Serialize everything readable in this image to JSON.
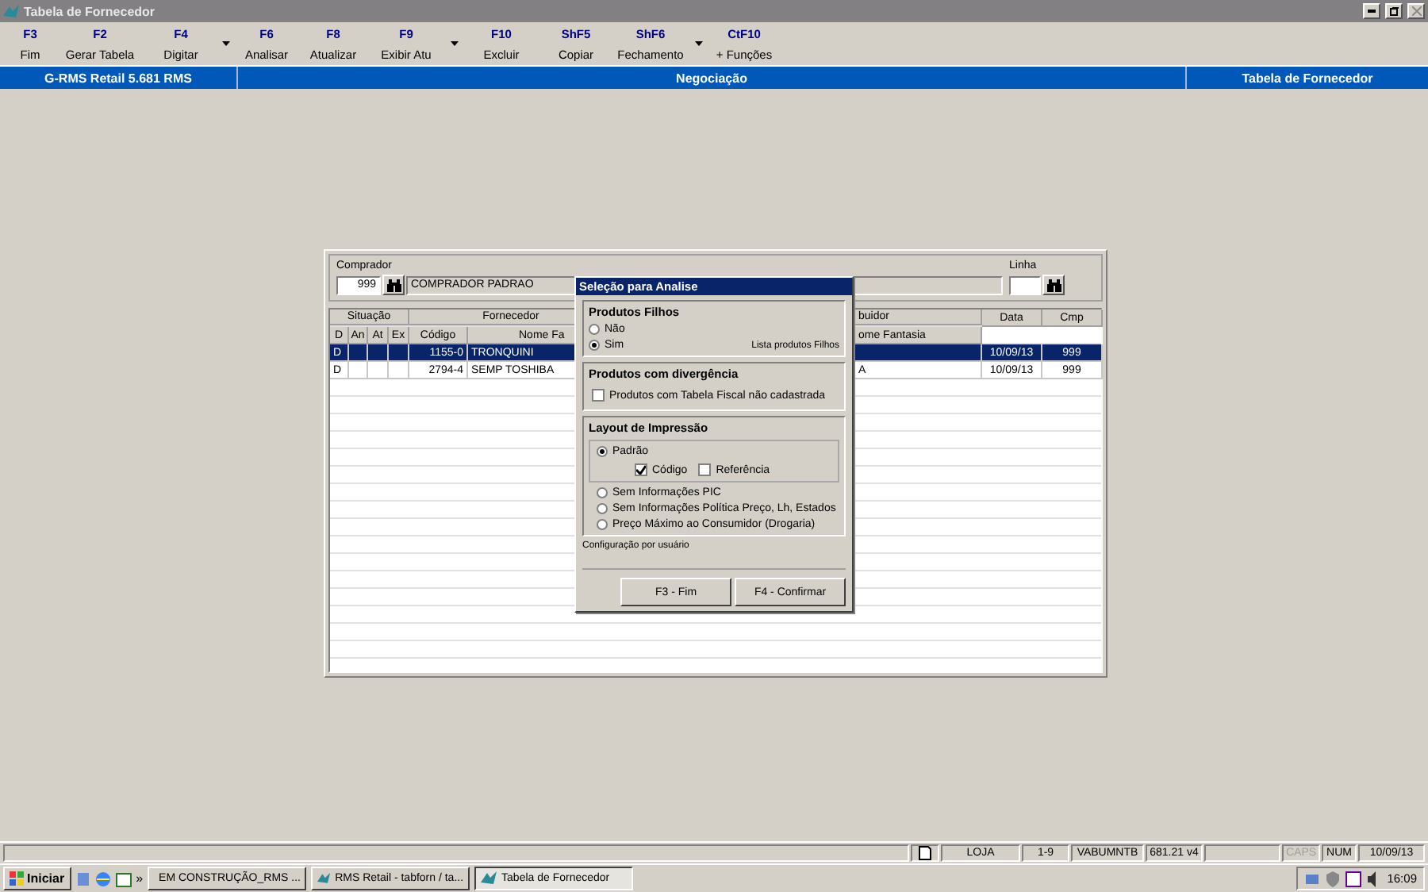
{
  "window": {
    "title": "Tabela de Fornecedor"
  },
  "toolbar": [
    {
      "key": "F3",
      "label": "Fim",
      "dropdown": false
    },
    {
      "key": "F2",
      "label": "Gerar Tabela",
      "dropdown": false
    },
    {
      "key": "F4",
      "label": "Digitar",
      "dropdown": true
    },
    {
      "key": "F6",
      "label": "Analisar",
      "dropdown": false
    },
    {
      "key": "F8",
      "label": "Atualizar",
      "dropdown": false
    },
    {
      "key": "F9",
      "label": "Exibir Atu",
      "dropdown": true
    },
    {
      "key": "F10",
      "label": "Excluir",
      "dropdown": false
    },
    {
      "key": "ShF5",
      "label": "Copiar",
      "dropdown": false
    },
    {
      "key": "ShF6",
      "label": "Fechamento",
      "dropdown": true
    },
    {
      "key": "CtF10",
      "label": "+ Funções",
      "dropdown": false
    }
  ],
  "header_bar": [
    "G-RMS Retail 5.681 RMS",
    "Negociação",
    "Tabela de Fornecedor"
  ],
  "panel": {
    "comprador_label": "Comprador",
    "comprador_code": "999",
    "comprador_name": "COMPRADOR PADRAO",
    "linha_label": "Linha"
  },
  "table": {
    "groups": [
      "Situação",
      "Fornecedor",
      "buidor"
    ],
    "columns": [
      "D",
      "An",
      "At",
      "Ex",
      "Código",
      "Nome Fa",
      "",
      "ome Fantasia",
      "Data",
      "Cmp"
    ],
    "rows": [
      {
        "selected": true,
        "cells": [
          "D",
          "",
          "",
          "",
          "1155-0",
          "TRONQUINI",
          "",
          "",
          "10/09/13",
          "999"
        ]
      },
      {
        "selected": false,
        "cells": [
          "D",
          "",
          "",
          "",
          "2794-4",
          "SEMP TOSHIBA",
          "",
          "A",
          "10/09/13",
          "999"
        ]
      }
    ]
  },
  "dialog": {
    "title": "Seleção para Analise",
    "filhos": {
      "title": "Produtos Filhos",
      "options": [
        {
          "label": "Não",
          "selected": false
        },
        {
          "label": "Sim",
          "selected": true
        }
      ],
      "note": "Lista produtos Filhos"
    },
    "divergencia": {
      "title": "Produtos com divergência",
      "checkbox": {
        "label": "Produtos com Tabela Fiscal não cadastrada",
        "checked": false
      }
    },
    "layout": {
      "title": "Layout de Impressão",
      "options": [
        {
          "label": "Padrão",
          "selected": true,
          "checkboxes": [
            {
              "label": "Código",
              "checked": true
            },
            {
              "label": "Referência",
              "checked": false
            }
          ]
        },
        {
          "label": "Sem Informações PIC",
          "selected": false
        },
        {
          "label": "Sem Informações Política Preço, Lh, Estados",
          "selected": false
        },
        {
          "label": "Preço Máximo ao Consumidor (Drogaria)",
          "selected": false
        }
      ]
    },
    "footer": "Configuração por usuário",
    "buttons": [
      "F3 - Fim",
      "F4 - Confirmar"
    ]
  },
  "status_bar": [
    {
      "text": "LOJA",
      "disabled": false
    },
    {
      "text": "1-9",
      "disabled": false
    },
    {
      "text": "VABUMNTB",
      "disabled": false
    },
    {
      "text": "681.21 v4",
      "disabled": false
    },
    {
      "text": "CAPS",
      "disabled": true
    },
    {
      "text": "NUM",
      "disabled": false
    },
    {
      "text": "10/09/13",
      "disabled": false
    }
  ],
  "taskbar": {
    "start": "Iniciar",
    "more": "»",
    "tasks": [
      {
        "label": "EM CONSTRUÇÃO_RMS ...",
        "selected": false
      },
      {
        "label": "RMS Retail - tabforn / ta...",
        "selected": false
      },
      {
        "label": "Tabela de Fornecedor",
        "selected": true
      }
    ],
    "clock": "16:09"
  }
}
